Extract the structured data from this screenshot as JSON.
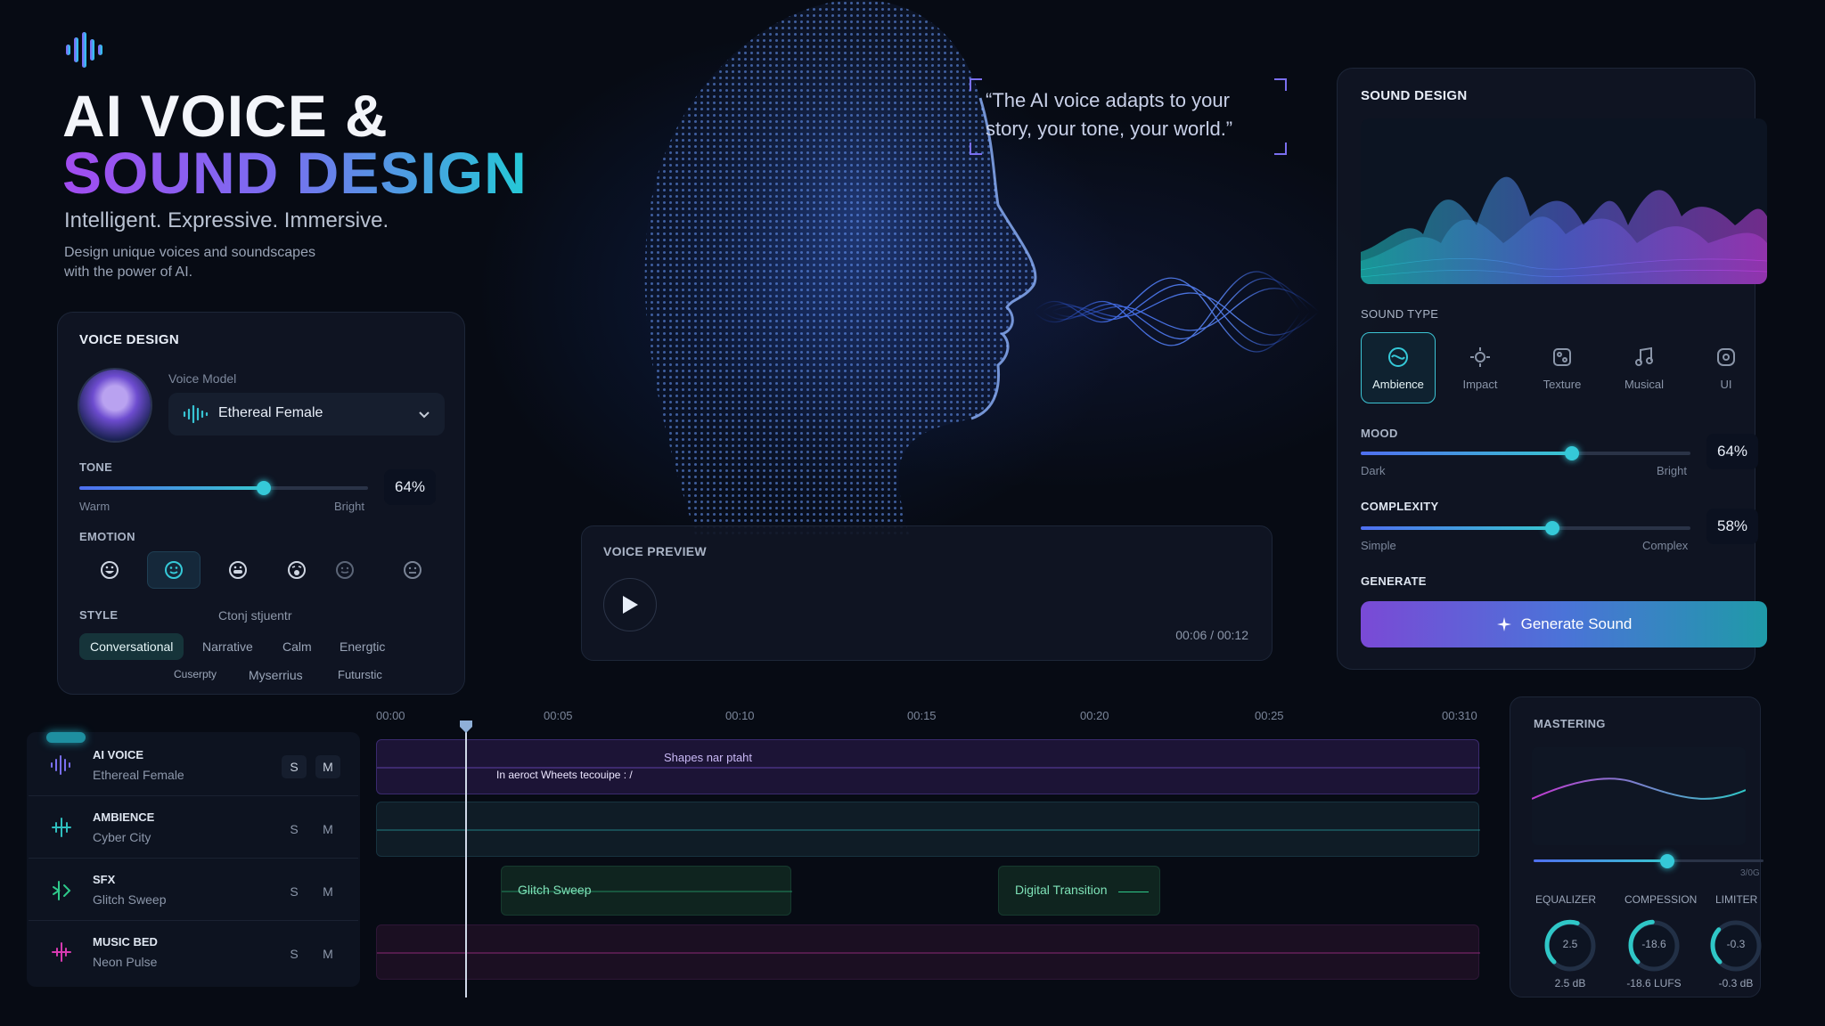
{
  "hero": {
    "title_line1": "AI VOICE &",
    "title_line2": "SOUND DESIGN",
    "tagline": "Intelligent. Expressive. Immersive.",
    "desc_line1": "Design unique voices and soundscapes",
    "desc_line2": "with the power of AI."
  },
  "quote": {
    "line1": "“The AI voice adapts to your",
    "line2": "story, your tone, your world.”"
  },
  "voice_design": {
    "title": "VOICE DESIGN",
    "voice_model_label": "Voice Model",
    "voice_model_value": "Ethereal Female",
    "tone_label": "TONE",
    "tone_value": "64%",
    "tone_level": 0.64,
    "tone_low": "Warm",
    "tone_high": "Bright",
    "emotion_label": "EMOTION",
    "style_label": "STYLE",
    "style_garbled": "Ctonj stjuentr",
    "styles_row1": [
      "Conversational",
      "Narrative",
      "Calm",
      "Energtic"
    ],
    "styles_row2": [
      "Cuserpty",
      "Myserrius",
      "Futurstic"
    ]
  },
  "voice_preview": {
    "title": "VOICE PREVIEW",
    "time": "00:06 / 00:12"
  },
  "sound_design": {
    "title": "SOUND DESIGN",
    "sound_type_label": "SOUND TYPE",
    "types": [
      "Ambience",
      "Impact",
      "Texture",
      "Musical",
      "UI"
    ],
    "mood_label": "MOOD",
    "mood_value": "64%",
    "mood_level": 0.64,
    "mood_low": "Dark",
    "mood_high": "Bright",
    "complexity_label": "COMPLEXITY",
    "complexity_value": "58%",
    "complexity_level": 0.58,
    "complexity_low": "Simple",
    "complexity_high": "Complex",
    "generate_label": "GENERATE",
    "generate_button": "Generate Sound"
  },
  "timeline": {
    "ticks": [
      "00:00",
      "00:05",
      "00:10",
      "00:15",
      "00:20",
      "00:25",
      "00:310"
    ],
    "tracks": [
      {
        "name": "AI VOICE",
        "sub": "Ethereal Female",
        "color": "#7a4ff0"
      },
      {
        "name": "AMBIENCE",
        "sub": "Cyber City",
        "color": "#2fbfbf"
      },
      {
        "name": "SFX",
        "sub": "Glitch Sweep",
        "color": "#2ec98a"
      },
      {
        "name": "MUSIC BED",
        "sub": "Neon Pulse",
        "color": "#d63ab0"
      }
    ],
    "solo": "S",
    "mute": "M",
    "voice_caption1": "Shapes nar ptaht",
    "voice_caption2": "In aeroct  Wheets tecouipe : /",
    "sfx_clip1": "Glitch Sweep",
    "sfx_clip2": "Digital Transition"
  },
  "mastering": {
    "title": "MASTERING",
    "slider_level": 0.58,
    "slider_end": "3/0G",
    "eq_label": "EQUALIZER",
    "comp_label": "COMPESSION",
    "lim_label": "LIMITER",
    "eq_dial": "2.5",
    "comp_dial": "-18.6",
    "lim_dial": "-0.3",
    "eq_value": "2.5 dB",
    "comp_value": "-18.6 LUFS",
    "lim_value": "-0.3 dB"
  }
}
